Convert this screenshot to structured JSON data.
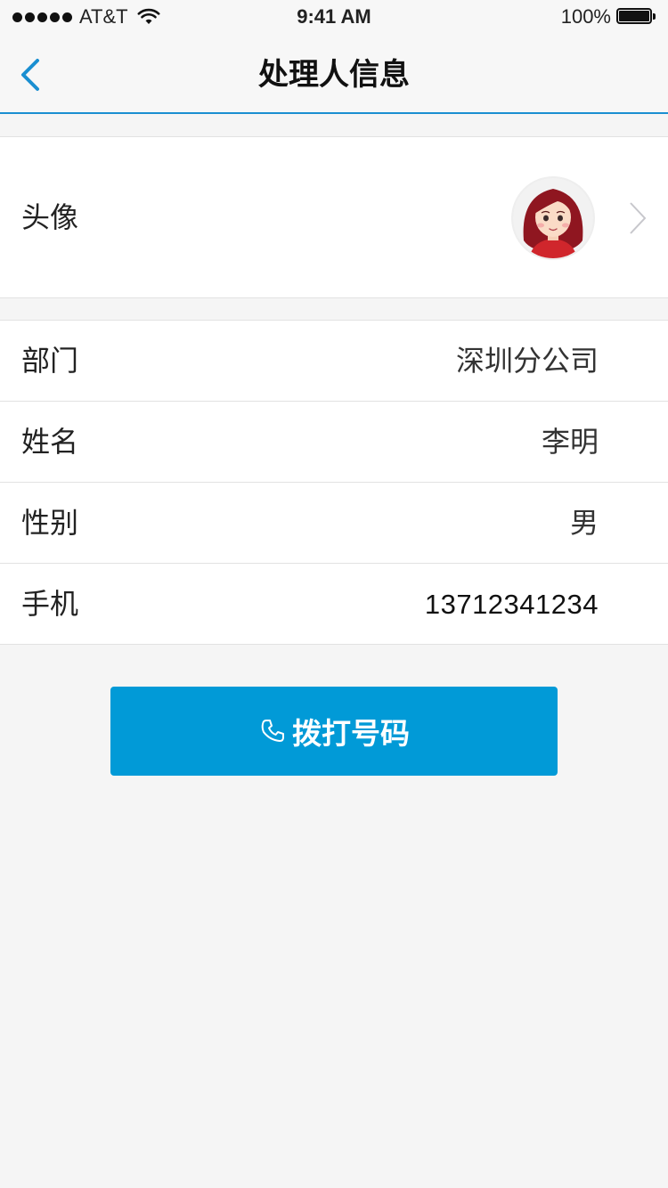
{
  "status_bar": {
    "carrier": "AT&T",
    "time": "9:41 AM",
    "battery": "100%"
  },
  "nav": {
    "title": "处理人信息"
  },
  "avatar_row": {
    "label": "头像"
  },
  "info_rows": [
    {
      "label": "部门",
      "value": "深圳分公司"
    },
    {
      "label": "姓名",
      "value": "李明"
    },
    {
      "label": "性别",
      "value": "男"
    },
    {
      "label": "手机",
      "value": "13712341234"
    }
  ],
  "call_button": {
    "label": "拨打号码"
  },
  "colors": {
    "accent": "#019ad7",
    "nav_border": "#1a8fd1",
    "background": "#f5f5f5"
  }
}
